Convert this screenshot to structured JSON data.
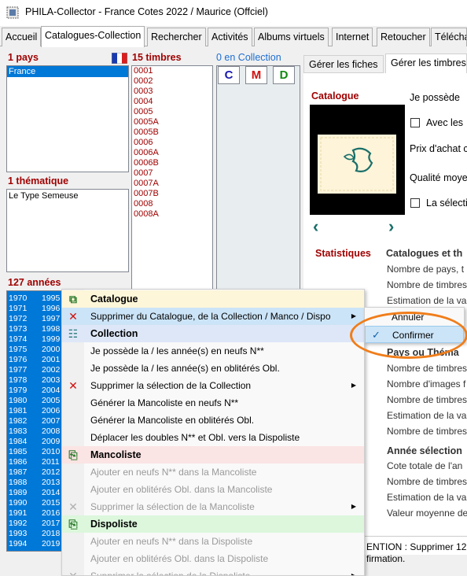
{
  "window": {
    "title": "PHILA-Collector - France Cotes 2022 / Maurice (Offciel)",
    "app_icon": "stamp-app-icon"
  },
  "tabs": [
    {
      "label": "Accueil"
    },
    {
      "label": "Catalogues-Collection"
    },
    {
      "label": "Rechercher"
    },
    {
      "label": "Activités"
    },
    {
      "label": "Albums virtuels"
    },
    {
      "label": "Internet"
    },
    {
      "label": "Retoucher"
    },
    {
      "label": "Téléchar"
    }
  ],
  "left_panel": {
    "pays_label": "1 pays",
    "pays_items": [
      "France"
    ],
    "flag": "french-flag-icon",
    "thematique_label": "1 thématique",
    "thematique_items": [
      "Le Type Semeuse"
    ],
    "annees_label": "127 années",
    "years_col1": [
      "1970",
      "1971",
      "1972",
      "1973",
      "1974",
      "1975",
      "1976",
      "1977",
      "1978",
      "1979",
      "1980",
      "1981",
      "1982",
      "1983",
      "1984",
      "1985",
      "1986",
      "1987",
      "1988",
      "1989",
      "1990",
      "1991",
      "1992",
      "1993",
      "1994"
    ],
    "years_col2": [
      "1995",
      "1996",
      "1997",
      "1998",
      "1999",
      "2000",
      "2001",
      "2002",
      "2003",
      "2004",
      "2005",
      "2006",
      "2007",
      "2008",
      "2009",
      "2010",
      "2011",
      "2012",
      "2013",
      "2014",
      "2015",
      "2016",
      "2017",
      "2018",
      "2019"
    ]
  },
  "stamps_panel": {
    "label": "15 timbres",
    "items": [
      "0001",
      "0002",
      "0003",
      "0004",
      "0005",
      "0005A",
      "0005B",
      "0006",
      "0006A",
      "0006B",
      "0007",
      "0007A",
      "0007B",
      "0008",
      "0008A"
    ]
  },
  "collection_panel": {
    "label": "0 en Collection",
    "btn_c": "C",
    "btn_m": "M",
    "btn_d": "D",
    "colors": {
      "c": "#1a1ab0",
      "m": "#d01010",
      "d": "#108a10"
    }
  },
  "right_panel": {
    "subtabs": [
      "Gérer les fiches",
      "Gérer les timbres"
    ],
    "catalogue_label": "Catalogue",
    "je_possede": "Je possède",
    "avec_les": "Avec les",
    "prix_achat": "Prix d'achat c",
    "qualite": "Qualité moye",
    "la_selection": "La sélecti",
    "statistiques_label": "Statistiques",
    "catalogues_heading": "Catalogues et th",
    "stats_lines_1": [
      "Nombre de pays, t",
      "Nombre de timbres",
      "Estimation de la va"
    ],
    "pays_heading": "Pays ou Théma",
    "stats_lines_2": [
      "Nombre de timbres",
      "Nombre d'images f",
      "Nombre de timbres",
      "Estimation de la va",
      "Nombre de timbres"
    ],
    "annee_heading": "Année sélection",
    "stats_lines_3": [
      "Cote totale de l'an",
      "Nombre de timbres",
      "Estimation de la va",
      "Valeur moyenne de"
    ],
    "status_line1": "ENTION : Supprimer 12",
    "status_line2": "firmation."
  },
  "context_menu": {
    "items": [
      {
        "type": "header",
        "icon": "copy-icon",
        "label": "Catalogue"
      },
      {
        "type": "item",
        "icon": "red-x-icon",
        "label": "Supprimer du Catalogue, de la Collection / Manco / Dispo",
        "submenu": true,
        "hover": true
      },
      {
        "type": "header",
        "icon": "document-icon",
        "label": "Collection"
      },
      {
        "type": "item",
        "icon": "",
        "label": "Je possède la / les année(s) en neufs N**"
      },
      {
        "type": "item",
        "icon": "",
        "label": "Je possède la / les année(s) en oblitérés Obl."
      },
      {
        "type": "item",
        "icon": "red-x-icon",
        "label": "Supprimer la sélection de la Collection",
        "submenu": true
      },
      {
        "type": "item",
        "icon": "",
        "label": "Générer la Mancoliste en neufs N**"
      },
      {
        "type": "item",
        "icon": "",
        "label": "Générer la Mancoliste en oblitérés Obl."
      },
      {
        "type": "item",
        "icon": "",
        "label": "Déplacer les doubles N** et Obl. vers la Dispoliste"
      },
      {
        "type": "header",
        "icon": "clipboard-icon",
        "label": "Mancoliste"
      },
      {
        "type": "disabled",
        "icon": "",
        "label": "Ajouter en neufs N** dans la Mancoliste"
      },
      {
        "type": "disabled",
        "icon": "",
        "label": "Ajouter en oblitérés Obl. dans la Mancoliste"
      },
      {
        "type": "disabled",
        "icon": "gray-x-icon",
        "label": "Supprimer la sélection de la Mancoliste",
        "submenu": true
      },
      {
        "type": "header",
        "icon": "clipboard-icon",
        "label": "Dispoliste"
      },
      {
        "type": "disabled",
        "icon": "",
        "label": "Ajouter en neufs N** dans la Dispoliste"
      },
      {
        "type": "disabled",
        "icon": "",
        "label": "Ajouter en oblitérés Obl. dans la Dispoliste"
      },
      {
        "type": "disabled",
        "icon": "gray-x-icon",
        "label": "Supprimer la sélection de la Dispoliste",
        "submenu": true
      }
    ],
    "header_colors": {
      "Catalogue": "#fdf6d8",
      "Collection": "#dde7f8",
      "Mancoliste": "#fbe4e4",
      "Dispoliste": "#dcf7dc"
    }
  },
  "submenu": {
    "items": [
      {
        "label": "Annuler",
        "checked": false
      },
      {
        "label": "Confirmer",
        "checked": true,
        "hover": true
      }
    ]
  },
  "highlight": {
    "color": "#f07d1a"
  }
}
